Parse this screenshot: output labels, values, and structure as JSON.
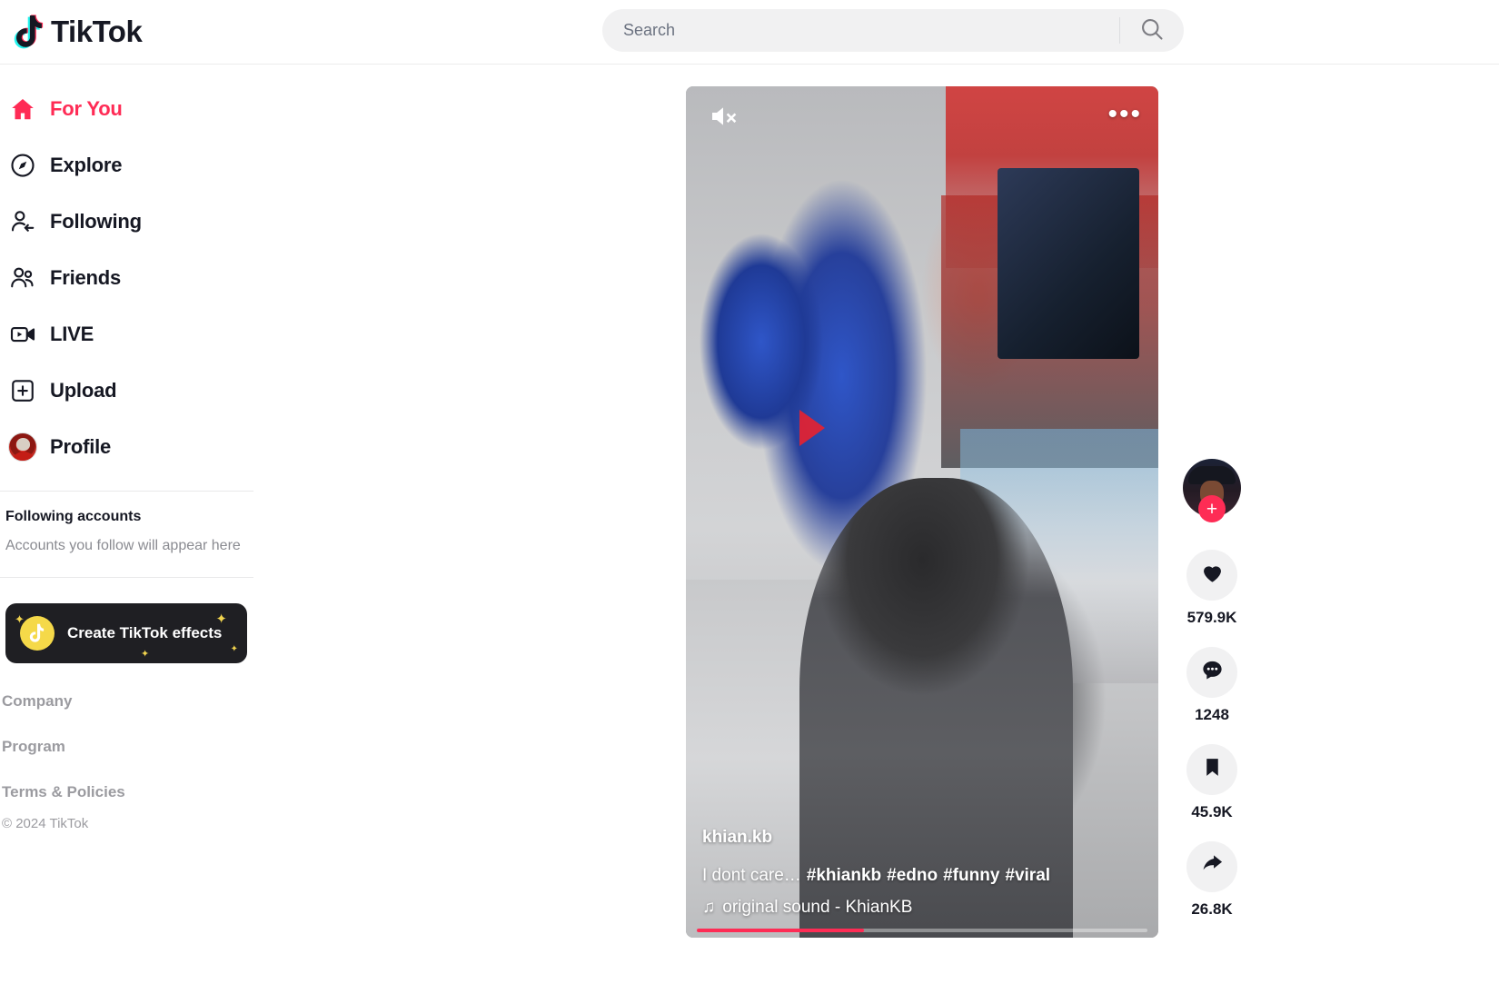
{
  "header": {
    "brand": "TikTok",
    "brand_icon": "tiktok-note-icon",
    "search": {
      "placeholder": "Search",
      "value": "",
      "button_icon": "search-icon"
    }
  },
  "sidebar": {
    "nav": [
      {
        "label": "For You",
        "icon": "home-icon",
        "active": true
      },
      {
        "label": "Explore",
        "icon": "compass-icon",
        "active": false
      },
      {
        "label": "Following",
        "icon": "user-follow-icon",
        "active": false
      },
      {
        "label": "Friends",
        "icon": "users-icon",
        "active": false
      },
      {
        "label": "LIVE",
        "icon": "live-video-icon",
        "active": false
      },
      {
        "label": "Upload",
        "icon": "plus-box-icon",
        "active": false
      },
      {
        "label": "Profile",
        "icon": "avatar-icon",
        "active": false
      }
    ],
    "following_accounts": {
      "title": "Following accounts",
      "empty_text": "Accounts you follow will appear here"
    },
    "effects_card": {
      "label": "Create TikTok effects",
      "icon": "tiktok-coin-icon"
    },
    "footer": {
      "links": [
        "Company",
        "Program",
        "Terms & Policies"
      ],
      "copyright": "© 2024 TikTok"
    },
    "accent_color": "#ff2b55"
  },
  "video": {
    "mute_icon": "speaker-muted-icon",
    "more_icon": "more-options-icon",
    "author": "khian.kb",
    "caption": "I dont care…",
    "hashtags": [
      "#khiankb",
      "#edno",
      "#funny",
      "#viral"
    ],
    "music_icon": "music-note-icon",
    "music": "original sound - KhianKB",
    "progress_percent": 37
  },
  "actions": {
    "follow_icon": "plus-icon",
    "avatar_icon": "creator-avatar",
    "items": [
      {
        "icon": "heart-icon",
        "count": "579.9K"
      },
      {
        "icon": "comment-icon",
        "count": "1248"
      },
      {
        "icon": "bookmark-icon",
        "count": "45.9K"
      },
      {
        "icon": "share-icon",
        "count": "26.8K"
      }
    ]
  },
  "colors": {
    "accent": "#fe2c55",
    "text": "#161823",
    "muted": "#9b9ba0",
    "chip_bg": "#f1f1f2"
  }
}
